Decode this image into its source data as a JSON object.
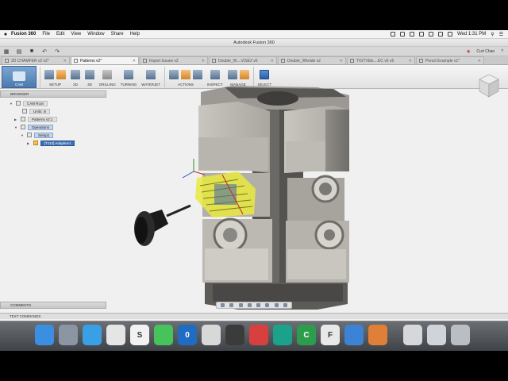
{
  "menubar": {
    "apple": "",
    "items": [
      "Fusion 360",
      "File",
      "Edit",
      "View",
      "Window",
      "Share",
      "Help"
    ],
    "clock": "Wed 1:31 PM"
  },
  "window": {
    "title": "Autodesk Fusion 360"
  },
  "quick_access": {
    "user": "Curt Chan"
  },
  "tabs": [
    {
      "label": "2D CHAMFER v2 v2*",
      "active": false
    },
    {
      "label": "Patterns v2*",
      "active": true
    },
    {
      "label": "Import Issues v2",
      "active": false
    },
    {
      "label": "Double_W....VISE2 v6",
      "active": false
    },
    {
      "label": "Double_Wknide v2",
      "active": false
    },
    {
      "label": "TIGTVblo....EC v5 v6",
      "active": false
    },
    {
      "label": "Pencil Example v1*",
      "active": false
    }
  ],
  "toolbar": {
    "workspace": "CAM",
    "groups": [
      {
        "label": "SETUP",
        "tools": 2,
        "style": "blue"
      },
      {
        "label": "2D",
        "tools": 1,
        "style": "blue"
      },
      {
        "label": "3D",
        "tools": 1,
        "style": "blue"
      },
      {
        "label": "DRILLING",
        "tools": 1,
        "style": "grey"
      },
      {
        "label": "TURNING",
        "tools": 1,
        "style": "blue"
      },
      {
        "label": "WATERJET",
        "tools": 1,
        "style": "blue"
      },
      {
        "label": "ACTIONS",
        "tools": 3,
        "style": "blue"
      },
      {
        "label": "INSPECT",
        "tools": 1,
        "style": "blue"
      },
      {
        "label": "MANAGE",
        "tools": 2,
        "style": "blue"
      },
      {
        "label": "SELECT",
        "tools": 1,
        "style": "sel"
      }
    ]
  },
  "browser": {
    "title": "BROWSER",
    "nodes": [
      {
        "label": "CAM Root",
        "style": "normal"
      },
      {
        "label": "Units: in",
        "style": "normal"
      },
      {
        "label": "Patterns v2:1",
        "style": "normal"
      },
      {
        "label": "Operations",
        "style": "sel"
      },
      {
        "label": "Setup1",
        "style": "sel"
      },
      {
        "label": "[T113] Adaptive1",
        "style": "hl"
      }
    ]
  },
  "comments": {
    "title": "COMMENTS"
  },
  "text_commands": {
    "title": "TEXT COMMANDS"
  },
  "dock": {
    "apps": [
      {
        "name": "finder-icon",
        "color": "#3b8fe0",
        "glyph": ""
      },
      {
        "name": "launchpad-icon",
        "color": "#8b95a3",
        "glyph": ""
      },
      {
        "name": "safari-icon",
        "color": "#3aa0e6",
        "glyph": ""
      },
      {
        "name": "chrome-icon",
        "color": "#e5e5e5",
        "glyph": ""
      },
      {
        "name": "scrivener-icon",
        "color": "#f2f2f2",
        "glyph": "S"
      },
      {
        "name": "messages-icon",
        "color": "#46c35a",
        "glyph": ""
      },
      {
        "name": "outlook-icon",
        "color": "#1f6dc2",
        "glyph": "0"
      },
      {
        "name": "preview-icon",
        "color": "#d8d8d8",
        "glyph": ""
      },
      {
        "name": "evernote-icon",
        "color": "#3b3b3b",
        "glyph": ""
      },
      {
        "name": "wunderlist-icon",
        "color": "#d8403f",
        "glyph": ""
      },
      {
        "name": "bookmark-icon",
        "color": "#1aa38a",
        "glyph": ""
      },
      {
        "name": "camtasia-icon",
        "color": "#2c9e4b",
        "glyph": "C"
      },
      {
        "name": "fusion360-icon",
        "color": "#e8e8e8",
        "glyph": "F"
      },
      {
        "name": "keynote-icon",
        "color": "#3c83d6",
        "glyph": ""
      },
      {
        "name": "flower-app-icon",
        "color": "#e07f37",
        "glyph": ""
      },
      {
        "name": "documents-folder-icon",
        "color": "#d5d7da",
        "glyph": ""
      },
      {
        "name": "mail-icon",
        "color": "#cfd4da",
        "glyph": ""
      },
      {
        "name": "trash-icon",
        "color": "#b9bec4",
        "glyph": ""
      }
    ]
  }
}
